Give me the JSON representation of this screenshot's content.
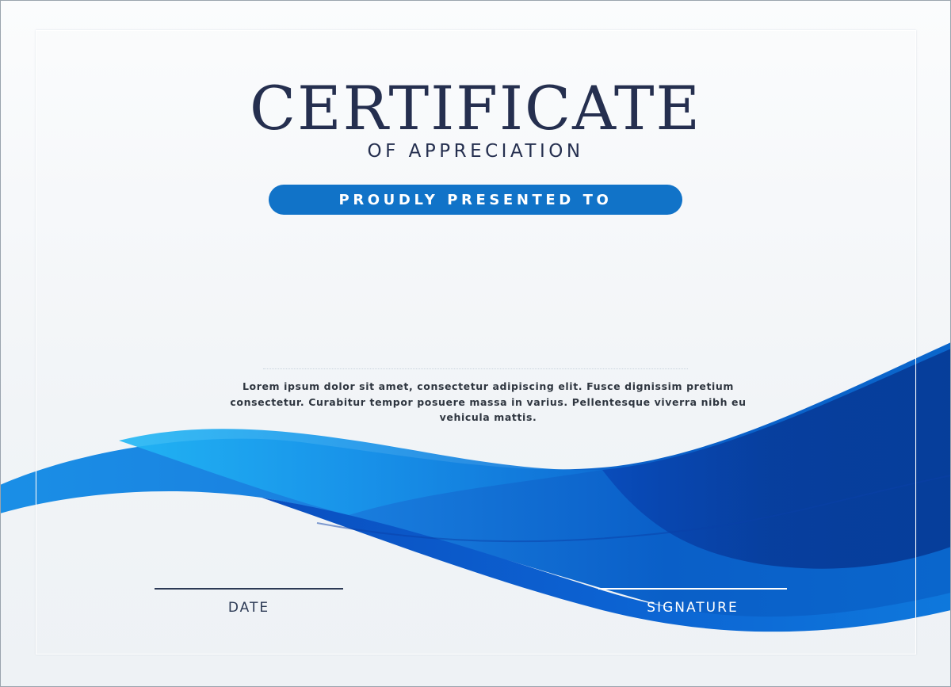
{
  "certificate": {
    "title": "CERTIFICATE",
    "subtitle": "OF APPRECIATION",
    "presented_label": "PROUDLY PRESENTED TO",
    "body_text": "Lorem ipsum dolor sit amet, consectetur adipiscing elit. Fusce dignissim pretium consectetur. Curabitur tempor posuere massa in varius. Pellentesque viverra nibh eu vehicula mattis.",
    "date_label": "DATE",
    "signature_label": "SIGNATURE"
  },
  "colors": {
    "navy_text": "#252f4f",
    "accent_blue": "#1173c8",
    "wave_light": "#0fb8f0",
    "wave_dark": "#062f8f",
    "background": "#f4f6f9"
  }
}
